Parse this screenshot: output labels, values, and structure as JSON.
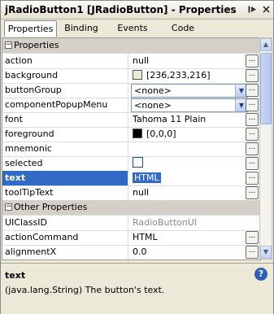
{
  "window": {
    "title": "jRadioButton1 [JRadioButton] - Properties"
  },
  "tabs": [
    "Properties",
    "Binding",
    "Events",
    "Code"
  ],
  "sections": {
    "properties": "Properties",
    "other": "Other Properties"
  },
  "rows": [
    {
      "name": "action",
      "value": "null"
    },
    {
      "name": "background",
      "value": "[236,233,216]"
    },
    {
      "name": "buttonGroup",
      "value": "<none>"
    },
    {
      "name": "componentPopupMenu",
      "value": "<none>"
    },
    {
      "name": "font",
      "value": "Tahoma 11 Plain"
    },
    {
      "name": "foreground",
      "value": "[0,0,0]"
    },
    {
      "name": "mnemonic",
      "value": ""
    },
    {
      "name": "selected",
      "value": ""
    },
    {
      "name": "text",
      "value": "HTML"
    },
    {
      "name": "toolTipText",
      "value": "null"
    }
  ],
  "other_rows": [
    {
      "name": "UIClassID",
      "value": "RadioButtonUI"
    },
    {
      "name": "actionCommand",
      "value": "HTML"
    },
    {
      "name": "alignmentX",
      "value": "0.0"
    }
  ],
  "colors": {
    "background_swatch": "#ece9d8",
    "foreground_swatch": "#000000",
    "selection": "#316ac5"
  },
  "buttons": {
    "ellipsis": "..."
  },
  "description": {
    "title": "text",
    "text": "(java.lang.String)  The button's text."
  }
}
